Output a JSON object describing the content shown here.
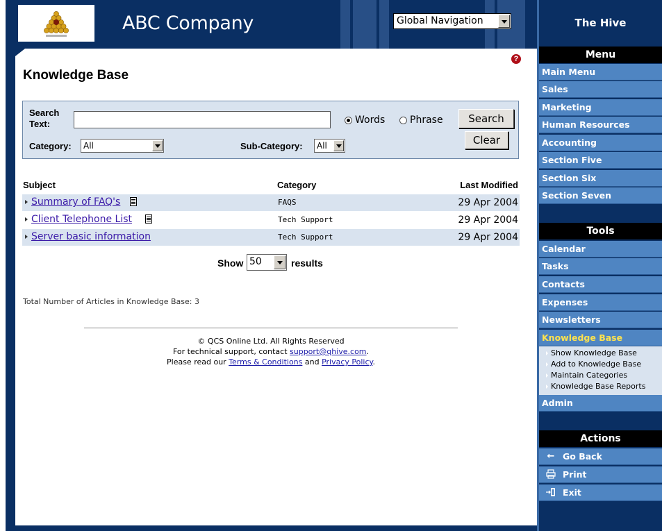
{
  "header": {
    "company": "ABC Company",
    "global_nav": "Global Navigation",
    "help_icon": "question-icon"
  },
  "page": {
    "title": "Knowledge Base"
  },
  "search": {
    "text_label": "Search Text:",
    "text_value": "",
    "words_label": "Words",
    "phrase_label": "Phrase",
    "mode_selected": "Words",
    "search_button": "Search",
    "clear_button": "Clear",
    "category_label": "Category:",
    "category_value": "All",
    "subcategory_label": "Sub-Category:",
    "subcategory_value": "All"
  },
  "table": {
    "headers": {
      "subject": "Subject",
      "category": "Category",
      "modified": "Last Modified"
    },
    "rows": [
      {
        "subject": "Summary of FAQ's",
        "category": "FAQS",
        "modified": "29 Apr 2004"
      },
      {
        "subject": "Client Telephone List",
        "category": "Tech Support",
        "modified": "29 Apr 2004"
      },
      {
        "subject": "Server basic information",
        "category": "Tech Support",
        "modified": "29 Apr 2004"
      }
    ]
  },
  "pager": {
    "show_label": "Show",
    "count": "50",
    "results_label": "results"
  },
  "total_text": "Total Number of Articles in Knowledge Base: 3",
  "footer": {
    "copyright": "© QCS Online Ltd. All Rights Reserved",
    "support_prefix": "For technical support, contact ",
    "support_email": "support@qhive.com",
    "support_suffix": ".",
    "read_prefix": "Please read our ",
    "terms": "Terms & Conditions",
    "and": " and ",
    "privacy": "Privacy Policy",
    "read_suffix": "."
  },
  "sidebar": {
    "title": "The Hive",
    "menu_header": "Menu",
    "menu": [
      "Main Menu",
      "Sales",
      "Marketing",
      "Human Resources",
      "Accounting",
      "Section Five",
      "Section Six",
      "Section Seven"
    ],
    "tools_header": "Tools",
    "tools": [
      "Calendar",
      "Tasks",
      "Contacts",
      "Expenses",
      "Newsletters",
      "Knowledge Base"
    ],
    "tools_active": "Knowledge Base",
    "kb_sub": [
      "Show Knowledge Base",
      "Add to Knowledge Base",
      "Maintain Categories",
      "Knowledge Base Reports"
    ],
    "admin": "Admin",
    "actions_header": "Actions",
    "actions": [
      {
        "label": "Go Back",
        "icon": "back-arrow-icon"
      },
      {
        "label": "Print",
        "icon": "printer-icon"
      },
      {
        "label": "Exit",
        "icon": "exit-icon"
      }
    ]
  },
  "colors": {
    "navy": "#0a2f63",
    "menu_blue": "#4f85c2",
    "panel": "#d9e3ef",
    "active": "#ffe34d"
  }
}
